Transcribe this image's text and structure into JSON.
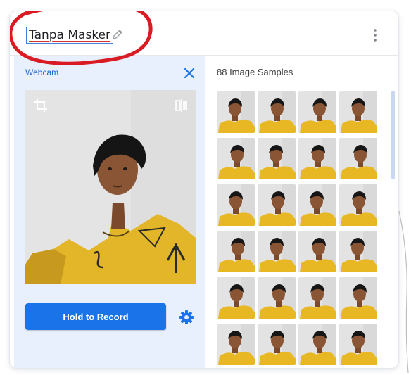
{
  "header": {
    "class_name": "Tanpa Masker",
    "edit_icon": "pencil-icon",
    "menu_icon": "more-vert-icon"
  },
  "webcam": {
    "title": "Webcam",
    "close_icon": "close-icon",
    "crop_icon": "crop-icon",
    "flip_icon": "flip-icon",
    "record_label": "Hold to Record",
    "settings_icon": "gear-icon"
  },
  "samples": {
    "title": "88 Image Samples",
    "visible_thumbnails": 24
  },
  "colors": {
    "accent": "#1a73e8",
    "panel_background": "#e8f0fe",
    "annotation": "#d91c24",
    "shirt": "#e8b824"
  }
}
